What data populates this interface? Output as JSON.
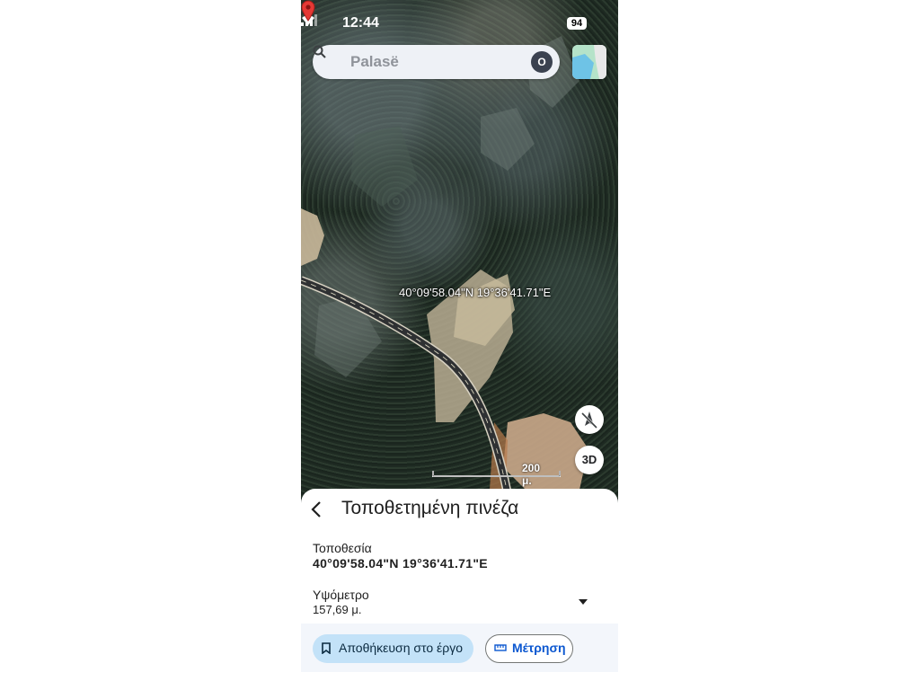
{
  "status_bar": {
    "time": "12:44",
    "battery": "94"
  },
  "search": {
    "placeholder": "Palasë",
    "avatar_letter": "O"
  },
  "map": {
    "pin_coordinates": "40°09'58.04\"N 19°36'41.71\"E",
    "scale_label": "200 μ.",
    "button_3d": "3D",
    "pin_color": "#e53935"
  },
  "sheet": {
    "title": "Τοποθετημένη πινέζα",
    "location_label": "Τοποθεσία",
    "location_value": "40°09'58.04\"N 19°36'41.71\"E",
    "altitude_label": "Υψόμετρο",
    "altitude_value": "157,69 μ."
  },
  "actions": {
    "save_label": "Αποθήκευση στο έργο",
    "measure_label": "Μέτρηση",
    "save_color": "#c3e2f8",
    "measure_color": "#0b57d0"
  }
}
